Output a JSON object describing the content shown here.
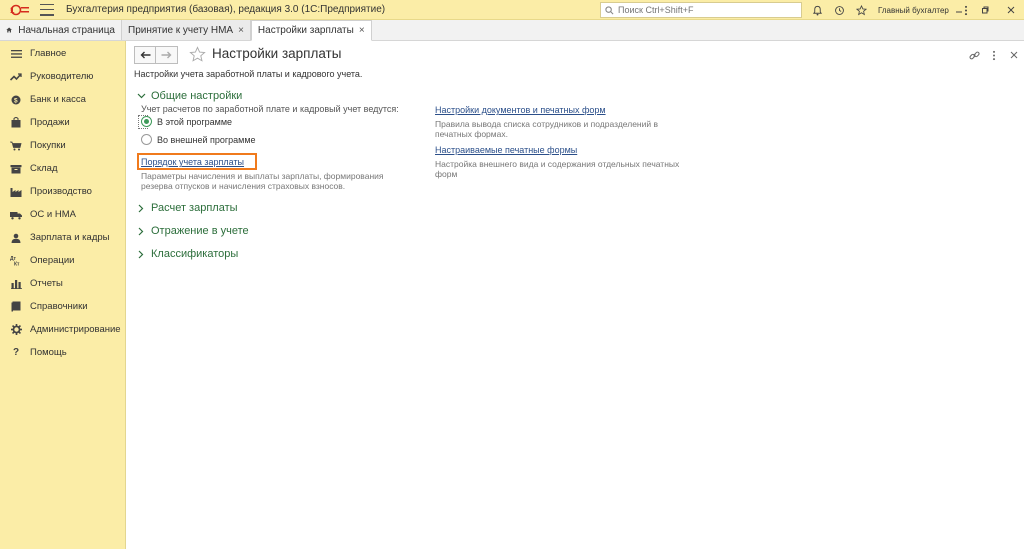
{
  "app": {
    "title": "Бухгалтерия предприятия (базовая), редакция 3.0  (1С:Предприятие)",
    "search_placeholder": "Поиск Ctrl+Shift+F",
    "user": "Главный бухгалтер"
  },
  "tabs": [
    {
      "label": "Начальная страница"
    },
    {
      "label": "Принятие к учету НМА",
      "close": "×"
    },
    {
      "label": "Настройки зарплаты",
      "close": "×"
    }
  ],
  "sidebar": {
    "items": [
      {
        "label": "Главное",
        "icon": "list-icon"
      },
      {
        "label": "Руководителю",
        "icon": "trend-icon"
      },
      {
        "label": "Банк и касса",
        "icon": "coin-icon"
      },
      {
        "label": "Продажи",
        "icon": "bag-icon"
      },
      {
        "label": "Покупки",
        "icon": "cart-icon"
      },
      {
        "label": "Склад",
        "icon": "warehouse-icon"
      },
      {
        "label": "Производство",
        "icon": "factory-icon"
      },
      {
        "label": "ОС и НМА",
        "icon": "truck-icon"
      },
      {
        "label": "Зарплата и кадры",
        "icon": "person-icon"
      },
      {
        "label": "Операции",
        "icon": "operations-icon"
      },
      {
        "label": "Отчеты",
        "icon": "bar-chart-icon"
      },
      {
        "label": "Справочники",
        "icon": "book-icon"
      },
      {
        "label": "Администрирование",
        "icon": "gear-icon"
      },
      {
        "label": "Помощь",
        "icon": "question-icon"
      }
    ]
  },
  "page": {
    "title": "Настройки зарплаты",
    "subtitle": "Настройки учета заработной платы и кадрового учета.",
    "general": {
      "heading": "Общие настройки",
      "radio_caption": "Учет расчетов по заработной плате и кадровый учет ведутся:",
      "radio_options": [
        {
          "label": "В этой программе",
          "checked": true
        },
        {
          "label": "Во внешней программе",
          "checked": false
        }
      ],
      "link1": "Порядок учета зарплаты",
      "link1_desc": [
        "Параметры начисления и выплаты зарплаты, формирования",
        "резерва отпусков и начисления страховых взносов."
      ],
      "link2": "Настройки документов и печатных форм",
      "link2_desc": [
        "Правила вывода списка сотрудников и подразделений в",
        "печатных формах."
      ],
      "link3": "Настраиваемые печатные формы",
      "link3_desc": [
        "Настройка внешнего вида и содержания отдельных печатных",
        "форм"
      ]
    },
    "sections": [
      {
        "label": "Расчет зарплаты"
      },
      {
        "label": "Отражение в учете"
      },
      {
        "label": "Классификаторы"
      }
    ],
    "colors": {
      "accent_green": "#2c6e3b",
      "link_blue": "#2b4f8a",
      "highlight_orange": "#f07a1c",
      "panel_yellow": "#fbeda7"
    }
  }
}
